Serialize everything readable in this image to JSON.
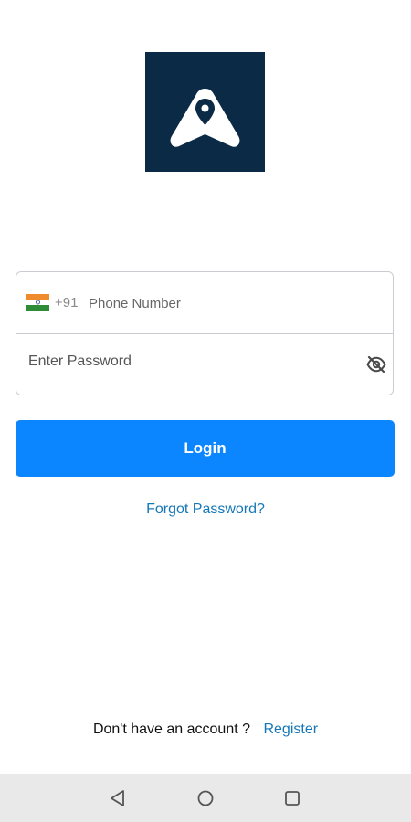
{
  "app": {
    "logo_icon": "location-pin-arrow-logo-icon",
    "logo_bg_color": "#0b2a45"
  },
  "login_form": {
    "country_flag_icon": "india-flag-icon",
    "country_code": "+91",
    "phone_placeholder": "Phone Number",
    "phone_value": "",
    "password_placeholder": "Enter Password",
    "password_value": "",
    "visibility_icon": "eye-off-icon"
  },
  "actions": {
    "login_label": "Login",
    "login_color": "#0b86ff",
    "forgot_password_label": "Forgot Password?",
    "link_color": "#1577b8"
  },
  "footer": {
    "prompt": "Don't have an account ?",
    "register_label": "Register"
  },
  "system_nav": {
    "back_icon": "triangle-back-icon",
    "home_icon": "circle-home-icon",
    "recents_icon": "square-recents-icon"
  }
}
